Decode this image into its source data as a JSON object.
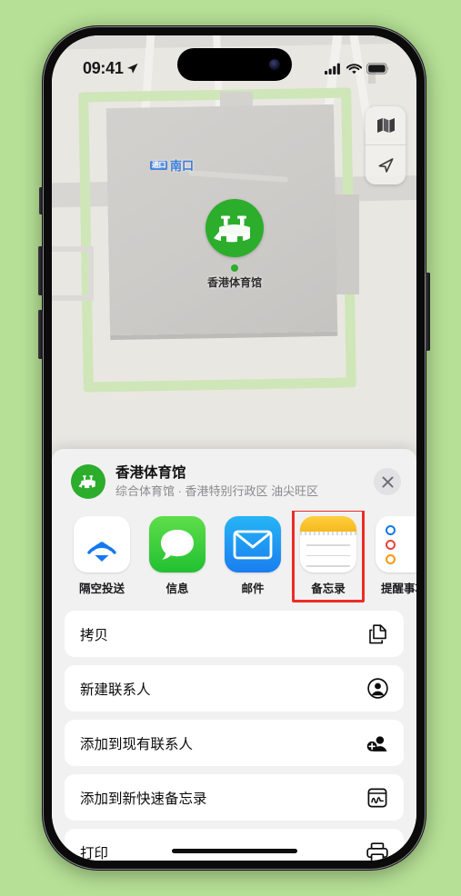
{
  "status_bar": {
    "time": "09:41",
    "location_arrow": "location-arrow",
    "cellular": "cellular-bars",
    "wifi": "wifi",
    "battery": "battery-full"
  },
  "map": {
    "entrance_label": {
      "badge": "进口",
      "text": "南口"
    },
    "poi_label": "香港体育馆",
    "controls": [
      {
        "name": "map-layers",
        "icon": "map-icon"
      },
      {
        "name": "current-location",
        "icon": "navigation-arrow-icon"
      }
    ]
  },
  "share_sheet": {
    "title": "香港体育馆",
    "subtitle": "综合体育馆 · 香港特别行政区 油尖旺区",
    "close_label": "×",
    "poi_icon": "stadium-icon",
    "apps": [
      {
        "label": "隔空投送",
        "icon": "airdrop-icon",
        "highlighted": false
      },
      {
        "label": "信息",
        "icon": "messages-icon",
        "highlighted": false
      },
      {
        "label": "邮件",
        "icon": "mail-icon",
        "highlighted": false
      },
      {
        "label": "备忘录",
        "icon": "notes-icon",
        "highlighted": true
      },
      {
        "label": "提醒事项",
        "icon": "reminders-icon",
        "highlighted": false
      }
    ],
    "actions": [
      {
        "label": "拷贝",
        "icon": "copy-icon"
      },
      {
        "label": "新建联系人",
        "icon": "person-circle-icon"
      },
      {
        "label": "添加到现有联系人",
        "icon": "person-add-icon"
      },
      {
        "label": "添加到新快速备忘录",
        "icon": "quick-note-icon"
      },
      {
        "label": "打印",
        "icon": "printer-icon"
      }
    ]
  },
  "colors": {
    "background": "#b5e095",
    "accent_green": "#2cad2c",
    "highlight_red": "#ee2b26",
    "map_label_blue": "#3a7ad9",
    "sheet_bg": "#f2f1f1"
  }
}
